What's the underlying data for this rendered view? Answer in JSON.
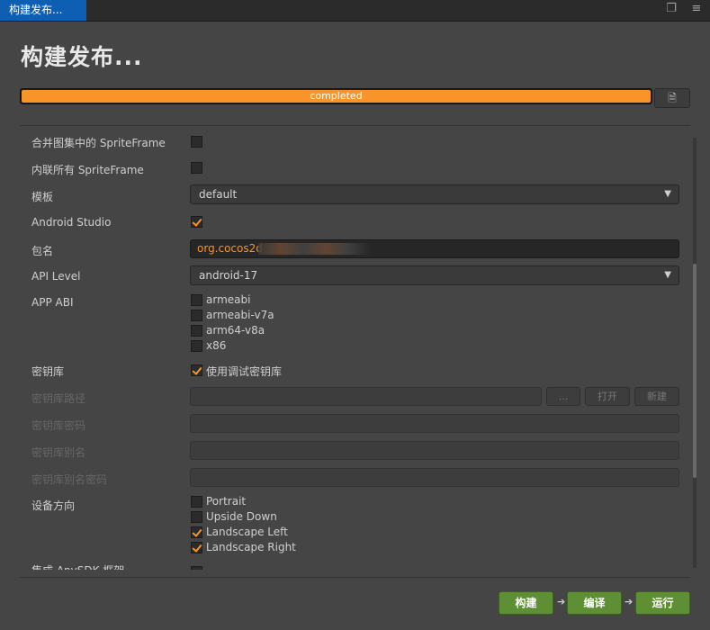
{
  "tab": {
    "label": "构建发布..."
  },
  "window": {
    "restore_icon": "restore-icon",
    "menu_icon": "menu-icon"
  },
  "page_title": "构建发布...",
  "progress": {
    "text": "completed",
    "percent": 100,
    "color": "#f7942a"
  },
  "log_button": {
    "icon": "document-icon"
  },
  "form": {
    "merge_spriteframe": {
      "label": "合并图集中的 SpriteFrame",
      "checked": false
    },
    "inline_spriteframe": {
      "label": "内联所有 SpriteFrame",
      "checked": false
    },
    "template": {
      "label": "模板",
      "value": "default"
    },
    "android_studio": {
      "label": "Android Studio",
      "checked": true
    },
    "package_name": {
      "label": "包名",
      "value": "org.cocos2d"
    },
    "api_level": {
      "label": "API Level",
      "value": "android-17"
    },
    "app_abi": {
      "label": "APP ABI",
      "options": [
        {
          "label": "armeabi",
          "checked": false
        },
        {
          "label": "armeabi-v7a",
          "checked": false
        },
        {
          "label": "arm64-v8a",
          "checked": false
        },
        {
          "label": "x86",
          "checked": false
        }
      ]
    },
    "keystore": {
      "label": "密钥库",
      "option_label": "使用调试密钥库",
      "checked": true
    },
    "keystore_path": {
      "label": "密钥库路径",
      "browse": "...",
      "open": "打开",
      "new": "新建"
    },
    "keystore_password": {
      "label": "密钥库密码"
    },
    "keystore_alias": {
      "label": "密钥库别名"
    },
    "keystore_alias_password": {
      "label": "密钥库别名密码"
    },
    "orientation": {
      "label": "设备方向",
      "options": [
        {
          "label": "Portrait",
          "checked": false
        },
        {
          "label": "Upside Down",
          "checked": false
        },
        {
          "label": "Landscape Left",
          "checked": true
        },
        {
          "label": "Landscape Right",
          "checked": true
        }
      ]
    },
    "partial_next": {
      "label": "集成 AnySDK 框架"
    }
  },
  "actions": {
    "build": "构建",
    "compile": "编译",
    "run": "运行",
    "color": "#5f8f35"
  }
}
